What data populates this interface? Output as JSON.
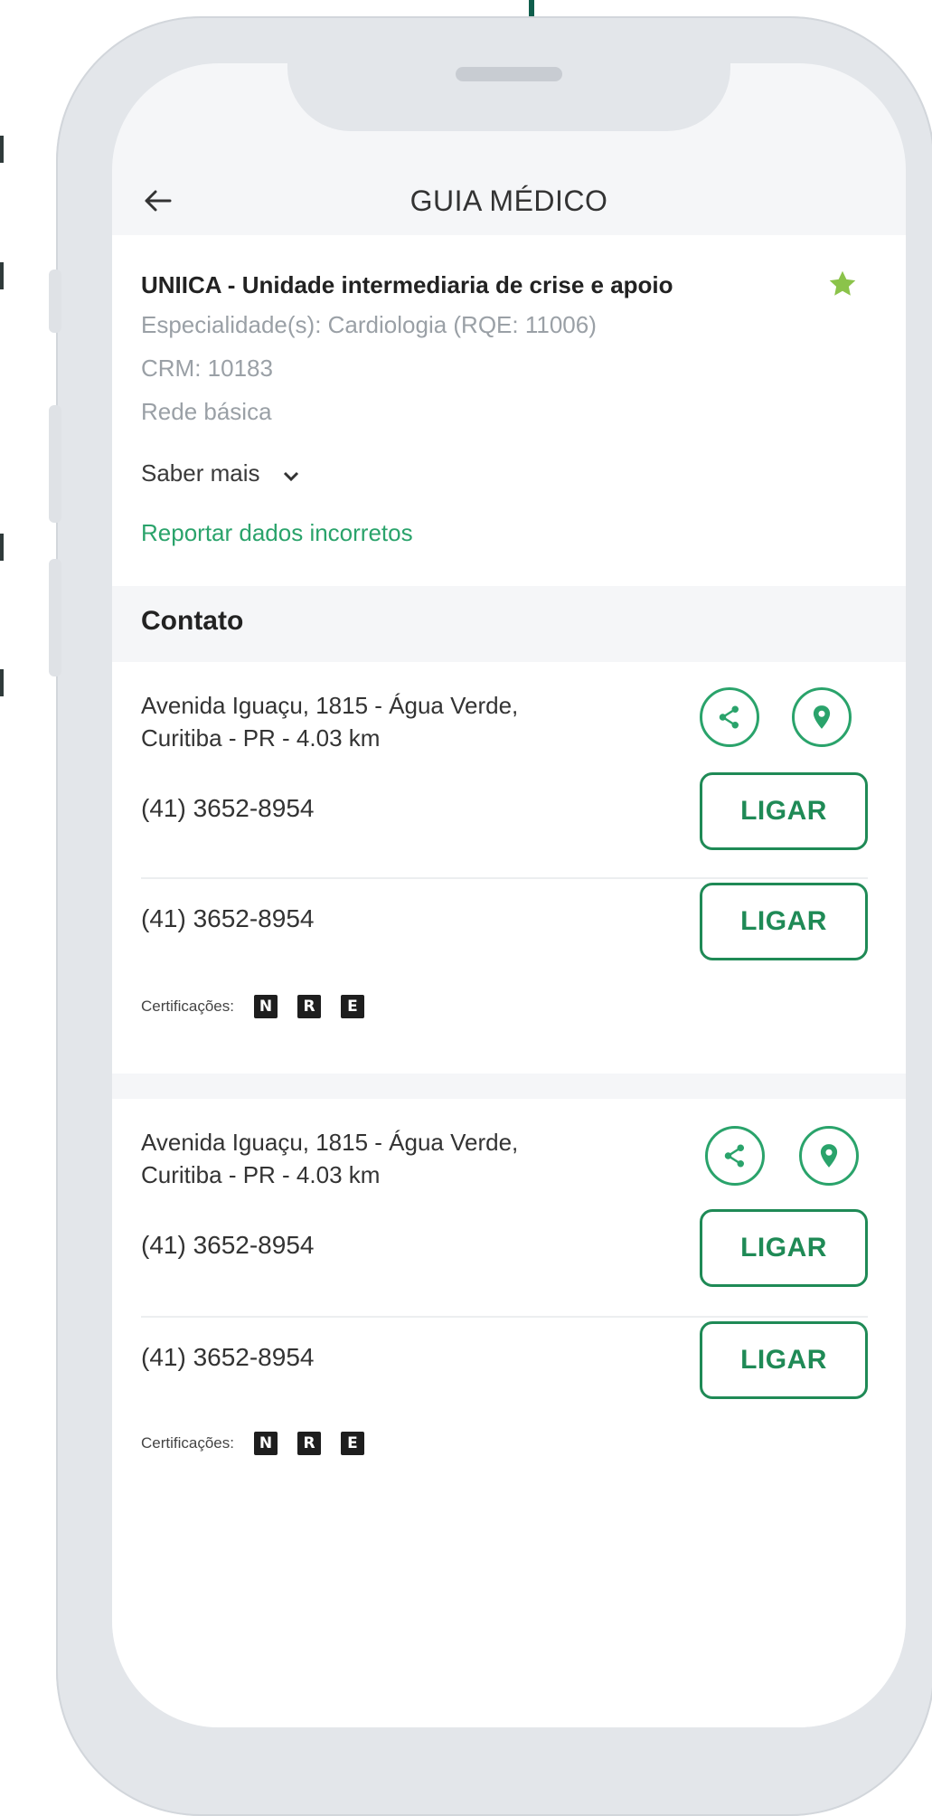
{
  "header": {
    "title": "GUIA MÉDICO"
  },
  "provider": {
    "name": "UNIICA - Unidade intermediaria de crise e apoio",
    "specialty": "Especialidade(s): Cardiologia (RQE: 11006)",
    "crm": "CRM: 10183",
    "network": "Rede básica",
    "saber_mais": "Saber mais",
    "report_link": "Reportar dados incorretos",
    "favorite": true,
    "accent_color": "#2aa36b"
  },
  "contact": {
    "section_title": "Contato",
    "locations": [
      {
        "address_line1": "Avenida Iguaçu, 1815 - Água Verde,",
        "address_line2": "Curitiba - PR - 4.03 km",
        "phones": [
          {
            "number": "(41) 3652-8954",
            "button": "LIGAR"
          },
          {
            "number": "(41) 3652-8954",
            "button": "LIGAR"
          }
        ],
        "cert_label": "Certificações:",
        "certs": [
          "N",
          "R",
          "E"
        ]
      },
      {
        "address_line1": "Avenida Iguaçu, 1815 - Água Verde,",
        "address_line2": "Curitiba - PR - 4.03 km",
        "phones": [
          {
            "number": "(41) 3652-8954",
            "button": "LIGAR"
          },
          {
            "number": "(41) 3652-8954",
            "button": "LIGAR"
          }
        ],
        "cert_label": "Certificações:",
        "certs": [
          "N",
          "R",
          "E"
        ]
      }
    ]
  }
}
